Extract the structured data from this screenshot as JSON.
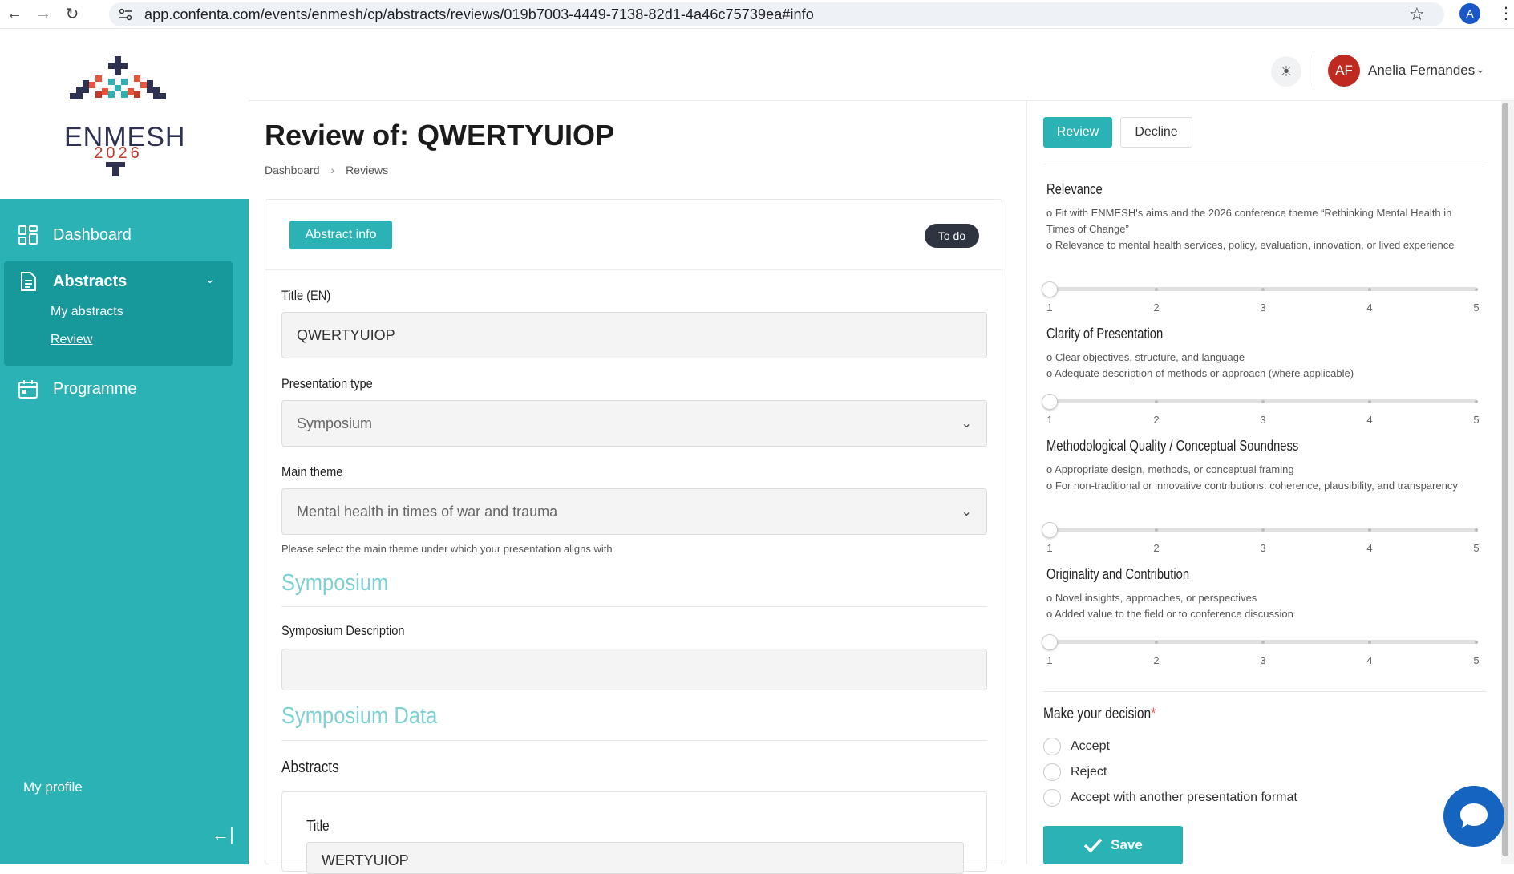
{
  "browser": {
    "url": "app.confenta.com/events/enmesh/cp/abstracts/reviews/019b7003-4449-7138-82d1-4a46c75739ea#info",
    "profile_initial": "A"
  },
  "logo": {
    "name": "ENMESH",
    "year": "2026"
  },
  "sidebar": {
    "items": [
      {
        "label": "Dashboard",
        "icon": "grid-icon"
      },
      {
        "label": "Abstracts",
        "icon": "document-icon"
      },
      {
        "label": "Programme",
        "icon": "calendar-icon"
      }
    ],
    "abstracts_sub": [
      "My abstracts",
      "Review"
    ],
    "profile_label": "My profile"
  },
  "header": {
    "user_initials": "AF",
    "user_name": "Anelia Fernandes"
  },
  "page": {
    "title": "Review of: QWERTYUIOP",
    "breadcrumb": [
      "Dashboard",
      "Reviews"
    ]
  },
  "card": {
    "tab_label": "Abstract info",
    "status_badge": "To do",
    "title_label": "Title (EN)",
    "title_value": "QWERTYUIOP",
    "presentation_label": "Presentation type",
    "presentation_value": "Symposium",
    "theme_label": "Main theme",
    "theme_value": "Mental health in times of war and trauma",
    "theme_help": "Please select the main theme under which your presentation aligns with",
    "section_symposium": "Symposium",
    "symposium_desc_label": "Symposium Description",
    "section_symposium_data": "Symposium Data",
    "abstracts_heading": "Abstracts",
    "inner_title_label": "Title",
    "inner_title_value": "WERTYUIOP"
  },
  "review": {
    "tab_review": "Review",
    "tab_decline": "Decline",
    "criteria": [
      {
        "title": "Relevance",
        "lines": [
          "o Fit with ENMESH's aims and the 2026 conference theme “Rethinking Mental Health in Times of Change”",
          "o Relevance to mental health services, policy, evaluation, innovation, or lived experience"
        ],
        "value": 1
      },
      {
        "title": "Clarity of Presentation",
        "lines": [
          "o Clear objectives, structure, and language",
          "o Adequate description of methods or approach (where applicable)"
        ],
        "value": 1
      },
      {
        "title": "Methodological Quality / Conceptual Soundness",
        "lines": [
          "o Appropriate design, methods, or conceptual framing",
          "o For non-traditional or innovative contributions: coherence, plausibility, and transparency"
        ],
        "value": 1
      },
      {
        "title": "Originality and Contribution",
        "lines": [
          "o Novel insights, approaches, or perspectives",
          "o Added value to the field or to conference discussion"
        ],
        "value": 1
      }
    ],
    "scale": [
      "1",
      "2",
      "3",
      "4",
      "5"
    ],
    "decision_label": "Make your decision",
    "required_mark": "*",
    "options": [
      "Accept",
      "Reject",
      "Accept with another presentation format"
    ],
    "save_label": "Save"
  },
  "colors": {
    "accent": "#2bb2b4",
    "accent_dark": "#17989b",
    "badge": "#2e3440",
    "avatar": "#c0291f"
  }
}
